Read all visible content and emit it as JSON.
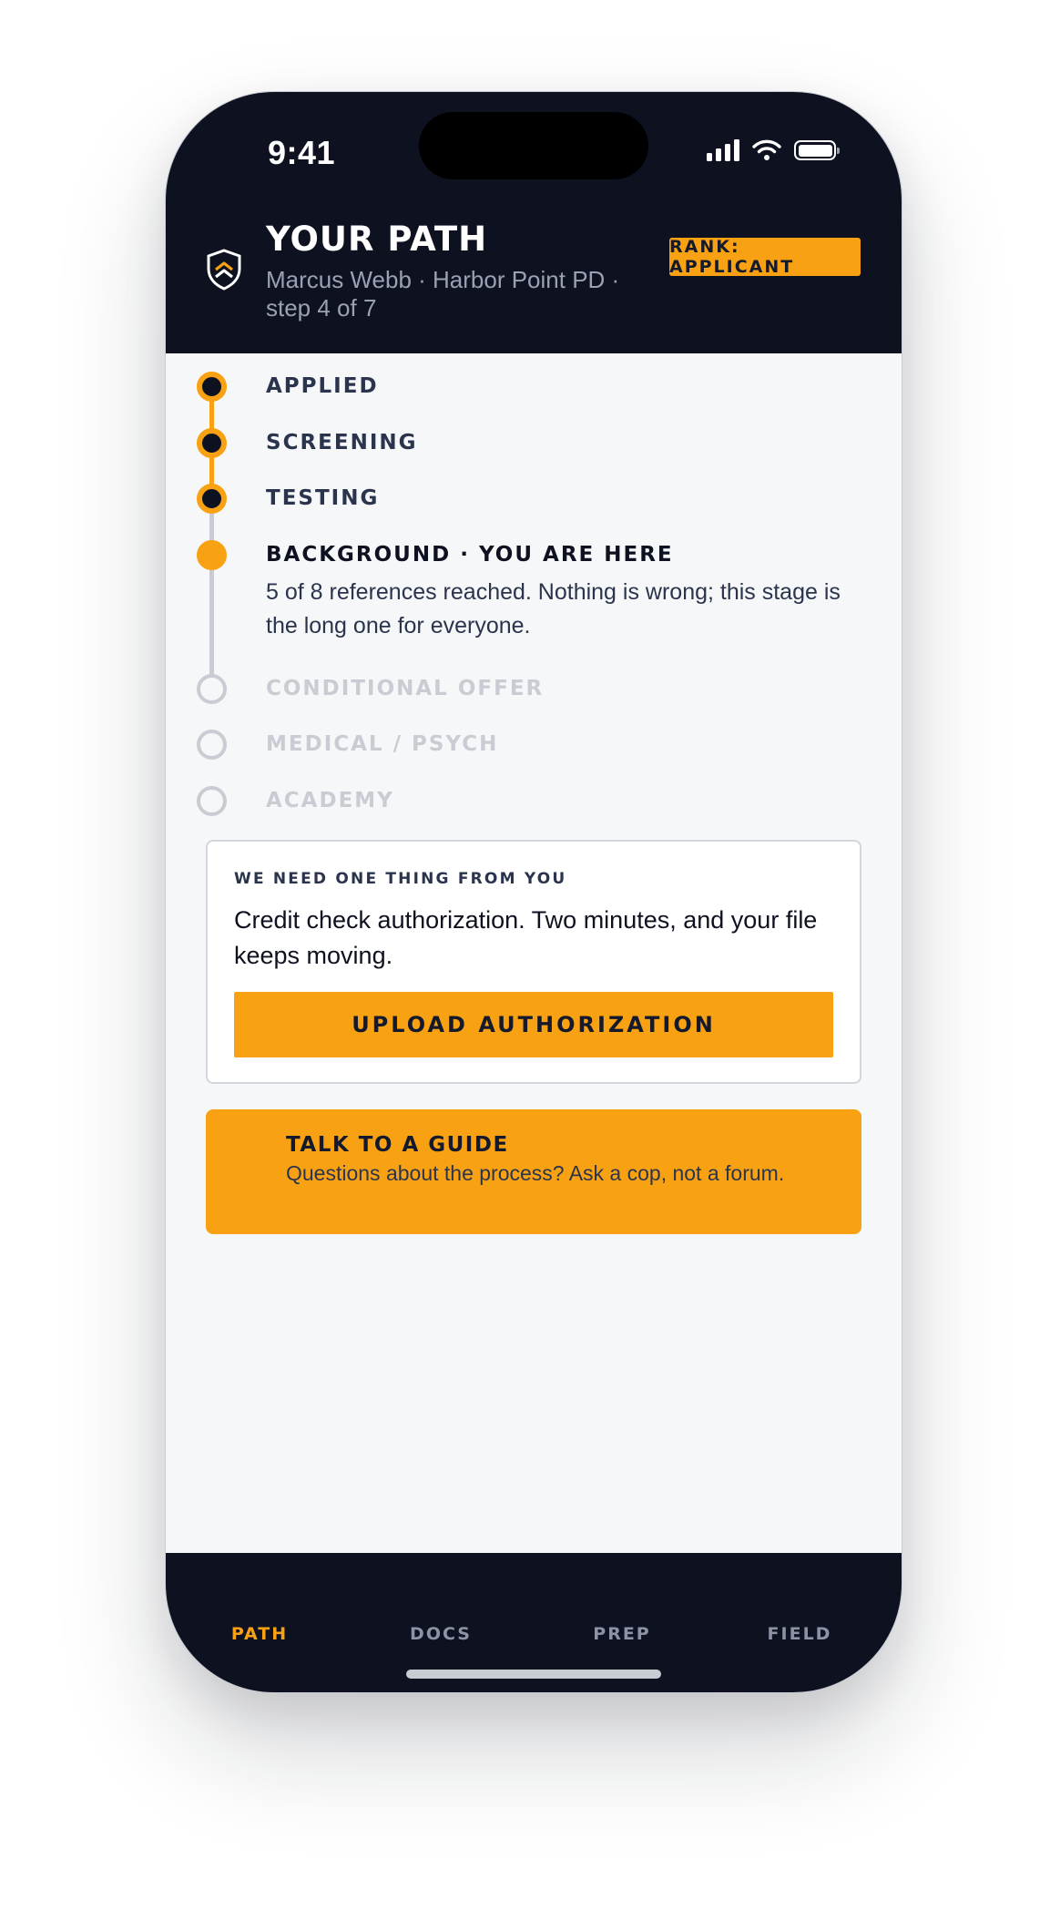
{
  "status_bar": {
    "time": "9:41"
  },
  "header": {
    "icon": "shield-chevron-icon",
    "title": "YOUR PATH",
    "subtitle": "Marcus Webb · Harbor Point PD · step 4 of 7",
    "rank_badge": "RANK: APPLICANT"
  },
  "timeline": {
    "steps": [
      {
        "label": "APPLIED",
        "state": "done"
      },
      {
        "label": "SCREENING",
        "state": "done"
      },
      {
        "label": "TESTING",
        "state": "done"
      },
      {
        "label": "BACKGROUND · YOU ARE HERE",
        "state": "current",
        "note": "5 of 8 references reached. Nothing is wrong; this stage is the long one for everyone."
      },
      {
        "label": "CONDITIONAL OFFER",
        "state": "todo"
      },
      {
        "label": "MEDICAL / PSYCH",
        "state": "todo"
      },
      {
        "label": "ACADEMY",
        "state": "todo"
      }
    ]
  },
  "action_card": {
    "kicker": "WE NEED ONE THING FROM YOU",
    "body": "Credit check authorization. Two minutes, and your file keeps moving.",
    "button_label": "UPLOAD AUTHORIZATION"
  },
  "guide_card": {
    "title": "TALK TO A GUIDE",
    "subtitle": "Questions about the process? Ask a cop, not a forum."
  },
  "tabbar": {
    "tabs": [
      {
        "label": "PATH",
        "active": true
      },
      {
        "label": "DOCS",
        "active": false
      },
      {
        "label": "PREP",
        "active": false
      },
      {
        "label": "FIELD",
        "active": false
      }
    ]
  },
  "colors": {
    "accent": "#f8a213",
    "navy": "#0e1220",
    "muted": "#c9ccd3",
    "text_secondary": "#2b344d"
  }
}
